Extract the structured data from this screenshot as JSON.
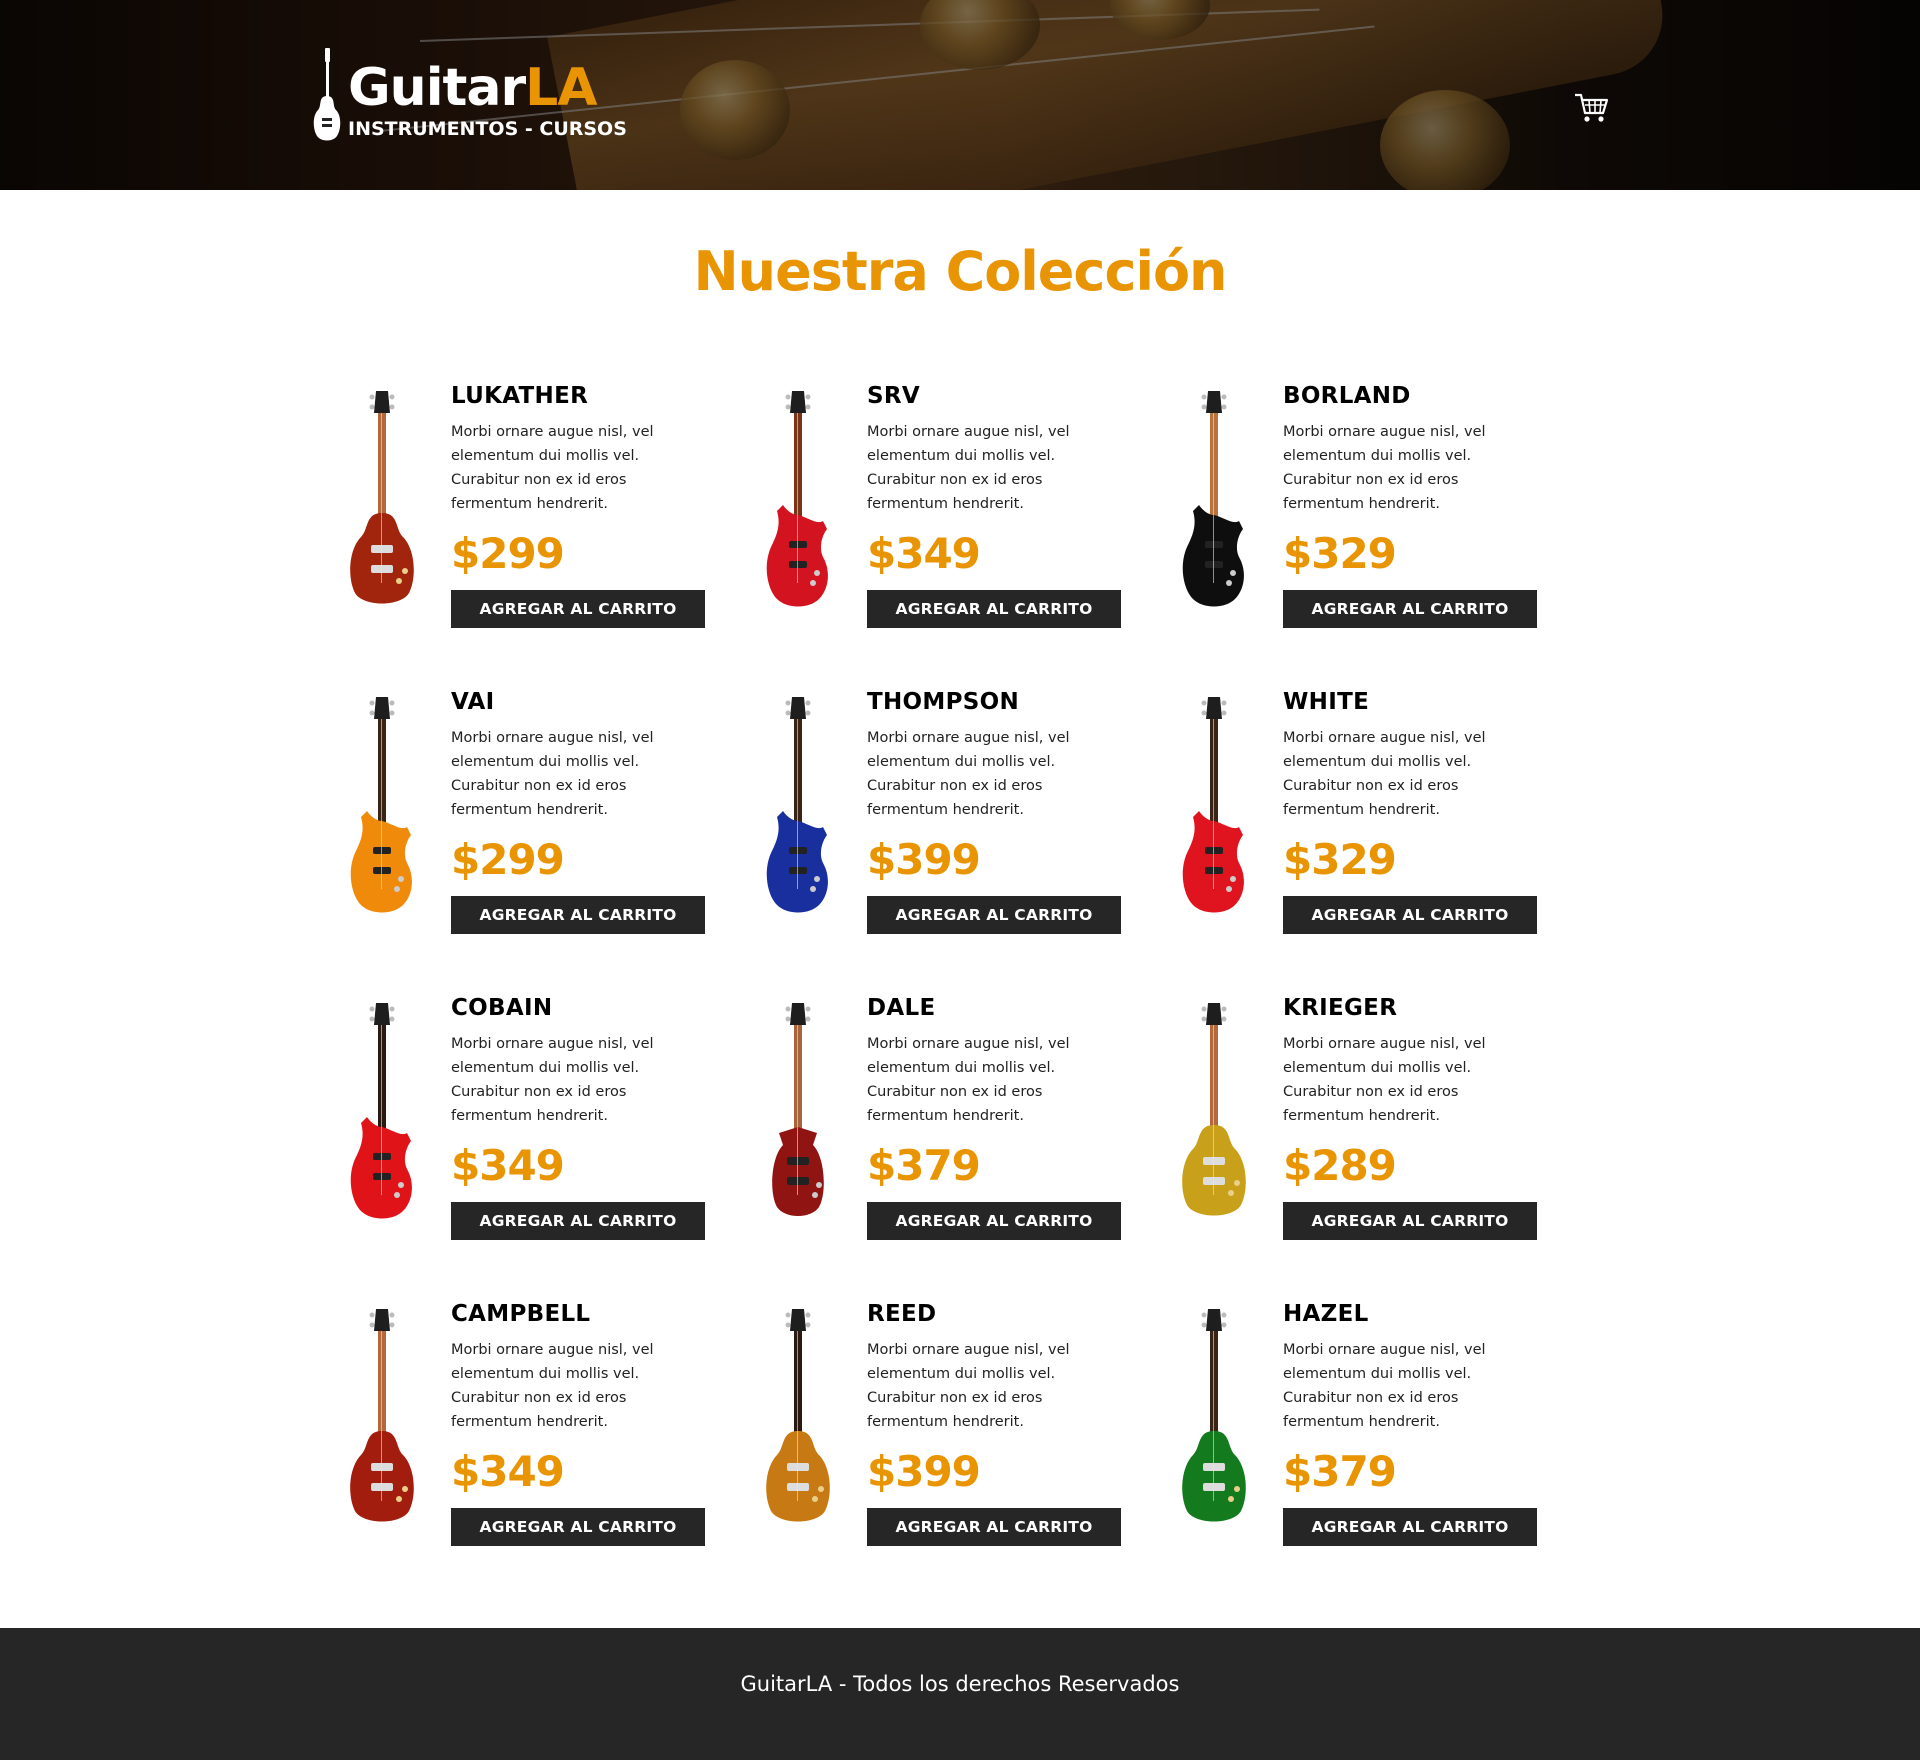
{
  "header": {
    "logo_main": "Guitar",
    "logo_accent": "LA",
    "logo_sub": "INSTRUMENTOS - CURSOS",
    "cart_icon": "shopping-cart-icon"
  },
  "main": {
    "title": "Nuestra Colección"
  },
  "colors": {
    "accent": "#e99402",
    "dark": "#262626"
  },
  "products": [
    {
      "name": "LUKATHER",
      "description": "Morbi ornare augue nisl, vel elementum dui mollis vel. Curabitur non ex id eros fermentum hendrerit.",
      "price": "$299",
      "button": "AGREGAR AL CARRITO",
      "style": "lespaul",
      "body_color": "#a1240c",
      "neck_color": "#b5683a"
    },
    {
      "name": "SRV",
      "description": "Morbi ornare augue nisl, vel elementum dui mollis vel. Curabitur non ex id eros fermentum hendrerit.",
      "price": "$349",
      "button": "AGREGAR AL CARRITO",
      "style": "strat",
      "body_color": "#d3131f",
      "neck_color": "#7a3418"
    },
    {
      "name": "BORLAND",
      "description": "Morbi ornare augue nisl, vel elementum dui mollis vel. Curabitur non ex id eros fermentum hendrerit.",
      "price": "$329",
      "button": "AGREGAR AL CARRITO",
      "style": "strat",
      "body_color": "#0e0e0e",
      "neck_color": "#b8733a"
    },
    {
      "name": "VAI",
      "description": "Morbi ornare augue nisl, vel elementum dui mollis vel. Curabitur non ex id eros fermentum hendrerit.",
      "price": "$299",
      "button": "AGREGAR AL CARRITO",
      "style": "strat",
      "body_color": "#f08a0a",
      "neck_color": "#3a2416"
    },
    {
      "name": "THOMPSON",
      "description": "Morbi ornare augue nisl, vel elementum dui mollis vel. Curabitur non ex id eros fermentum hendrerit.",
      "price": "$399",
      "button": "AGREGAR AL CARRITO",
      "style": "strat",
      "body_color": "#1a2f9e",
      "neck_color": "#3a2416"
    },
    {
      "name": "WHITE",
      "description": "Morbi ornare augue nisl, vel elementum dui mollis vel. Curabitur non ex id eros fermentum hendrerit.",
      "price": "$329",
      "button": "AGREGAR AL CARRITO",
      "style": "strat",
      "body_color": "#e0141e",
      "neck_color": "#3a2416"
    },
    {
      "name": "COBAIN",
      "description": "Morbi ornare augue nisl, vel elementum dui mollis vel. Curabitur non ex id eros fermentum hendrerit.",
      "price": "$349",
      "button": "AGREGAR AL CARRITO",
      "style": "strat",
      "body_color": "#e01418",
      "neck_color": "#2a1a12"
    },
    {
      "name": "DALE",
      "description": "Morbi ornare augue nisl, vel elementum dui mollis vel. Curabitur non ex id eros fermentum hendrerit.",
      "price": "$379",
      "button": "AGREGAR AL CARRITO",
      "style": "sg",
      "body_color": "#8f1412",
      "neck_color": "#a8643a"
    },
    {
      "name": "KRIEGER",
      "description": "Morbi ornare augue nisl, vel elementum dui mollis vel. Curabitur non ex id eros fermentum hendrerit.",
      "price": "$289",
      "button": "AGREGAR AL CARRITO",
      "style": "lespaul",
      "body_color": "#c9a019",
      "neck_color": "#b5683a"
    },
    {
      "name": "CAMPBELL",
      "description": "Morbi ornare augue nisl, vel elementum dui mollis vel. Curabitur non ex id eros fermentum hendrerit.",
      "price": "$349",
      "button": "AGREGAR AL CARRITO",
      "style": "lespaul",
      "body_color": "#a21d0e",
      "neck_color": "#b5683a"
    },
    {
      "name": "REED",
      "description": "Morbi ornare augue nisl, vel elementum dui mollis vel. Curabitur non ex id eros fermentum hendrerit.",
      "price": "$399",
      "button": "AGREGAR AL CARRITO",
      "style": "lespaul",
      "body_color": "#c77a14",
      "neck_color": "#2a1a12"
    },
    {
      "name": "HAZEL",
      "description": "Morbi ornare augue nisl, vel elementum dui mollis vel. Curabitur non ex id eros fermentum hendrerit.",
      "price": "$379",
      "button": "AGREGAR AL CARRITO",
      "style": "lespaul",
      "body_color": "#137a1e",
      "neck_color": "#3a2416"
    }
  ],
  "footer": {
    "text": "GuitarLA - Todos los derechos Reservados"
  }
}
